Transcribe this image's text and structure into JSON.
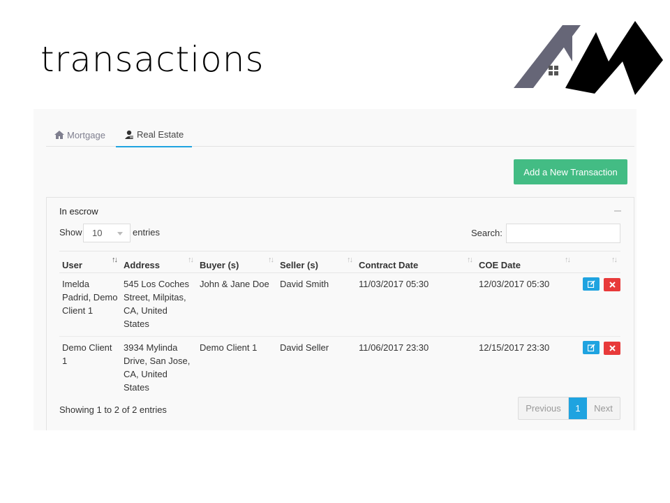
{
  "page": {
    "title": "transactions"
  },
  "tabs": [
    {
      "label": "Mortgage",
      "icon": "home-icon"
    },
    {
      "label": "Real Estate",
      "icon": "agent-icon",
      "active": true
    }
  ],
  "toolbar": {
    "add_label": "Add a New Transaction"
  },
  "box": {
    "title": "In escrow",
    "show_label": "Show",
    "length_value": "10",
    "entries_label": "entries",
    "search_label": "Search:",
    "search_value": ""
  },
  "table": {
    "columns": [
      "User",
      "Address",
      "Buyer (s)",
      "Seller (s)",
      "Contract Date",
      "COE Date"
    ],
    "rows": [
      {
        "user": "Imelda Padrid, Demo Client 1",
        "address": "545 Los Coches Street, Milpitas, CA, United States",
        "buyer": "John & Jane Doe",
        "seller": "David Smith",
        "contract_date": "11/03/2017 05:30",
        "coe_date": "12/03/2017 05:30"
      },
      {
        "user": "Demo Client 1",
        "address": "3934 Mylinda Drive, San Jose, CA, United States",
        "buyer": "Demo Client 1",
        "seller": "David Seller",
        "contract_date": "11/06/2017 23:30",
        "coe_date": "12/15/2017 23:30"
      }
    ]
  },
  "footer": {
    "info": "Showing 1 to 2 of 2 entries",
    "prev_label": "Previous",
    "current_page": "1",
    "next_label": "Next"
  },
  "colors": {
    "accent": "#1fa3e0",
    "success": "#43bc84",
    "danger": "#e83a3a"
  }
}
